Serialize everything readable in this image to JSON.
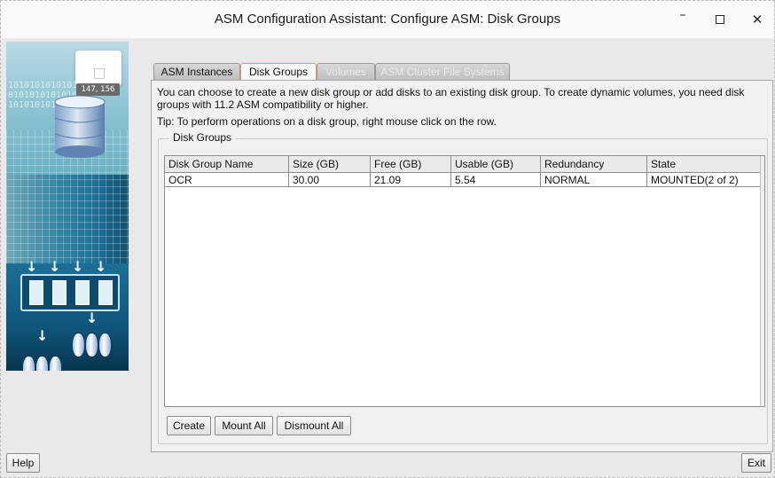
{
  "window": {
    "title": "ASM Configuration Assistant: Configure ASM: Disk Groups",
    "minimize_glyph": "–",
    "close_glyph": "✕"
  },
  "art": {
    "bits": "10101010101010\n01010101010101\n10101010101010",
    "coords_label": "147, 156"
  },
  "tabs": [
    {
      "label": "ASM Instances",
      "state": "normal"
    },
    {
      "label": "Disk Groups",
      "state": "active"
    },
    {
      "label": "Volumes",
      "state": "disabled"
    },
    {
      "label": "ASM Cluster File Systems",
      "state": "disabled"
    }
  ],
  "info": {
    "line1": "You can choose to create a new disk group or add disks to an existing disk group. To create dynamic volumes, you need disk",
    "line2": "groups with 11.2 ASM compatibility or higher.",
    "tip": "Tip: To perform operations on a disk group, right mouse click on the row."
  },
  "group": {
    "label": "Disk Groups",
    "columns": [
      "Disk Group Name",
      "Size (GB)",
      "Free (GB)",
      "Usable (GB)",
      "Redundancy",
      "State"
    ],
    "rows": [
      [
        "OCR",
        "30.00",
        "21.09",
        "5.54",
        "NORMAL",
        "MOUNTED(2 of 2)"
      ]
    ]
  },
  "buttons": {
    "create": "Create",
    "mount_all": "Mount All",
    "dismount_all": "Dismount All",
    "help": "Help",
    "exit": "Exit"
  },
  "colors": {
    "active_tab_border": "#d9a441",
    "art_blue": "#1d6d95"
  }
}
